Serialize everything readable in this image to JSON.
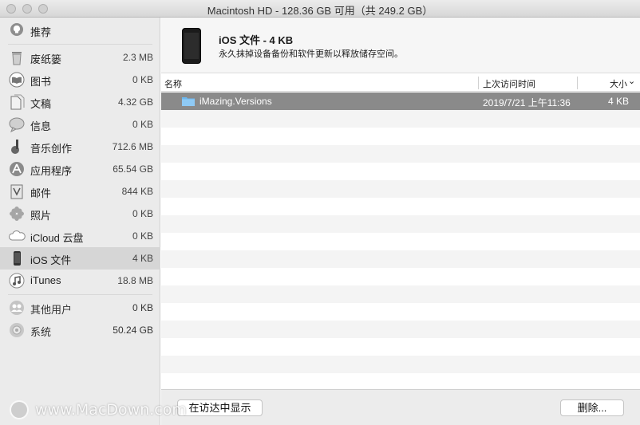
{
  "window": {
    "title": "Macintosh HD - 128.36 GB 可用（共 249.2 GB）"
  },
  "sidebar": {
    "items": [
      {
        "label": "推荐",
        "size": "",
        "icon": "lightbulb-icon"
      },
      {
        "label": "废纸篓",
        "size": "2.3 MB",
        "icon": "trash-icon"
      },
      {
        "label": "图书",
        "size": "0 KB",
        "icon": "books-icon"
      },
      {
        "label": "文稿",
        "size": "4.32 GB",
        "icon": "documents-icon"
      },
      {
        "label": "信息",
        "size": "0 KB",
        "icon": "messages-icon"
      },
      {
        "label": "音乐创作",
        "size": "712.6 MB",
        "icon": "guitar-icon"
      },
      {
        "label": "应用程序",
        "size": "65.54 GB",
        "icon": "app-store-icon"
      },
      {
        "label": "邮件",
        "size": "844 KB",
        "icon": "mail-icon"
      },
      {
        "label": "照片",
        "size": "0 KB",
        "icon": "photos-icon"
      },
      {
        "label": "iCloud 云盘",
        "size": "0 KB",
        "icon": "cloud-icon"
      },
      {
        "label": "iOS 文件",
        "size": "4 KB",
        "icon": "iphone-icon"
      },
      {
        "label": "iTunes",
        "size": "18.8 MB",
        "icon": "music-note-icon"
      },
      {
        "label": "其他用户",
        "size": "0 KB",
        "icon": "users-icon"
      },
      {
        "label": "系统",
        "size": "50.24 GB",
        "icon": "gear-icon"
      }
    ],
    "selected_index": 10
  },
  "header": {
    "title": "iOS 文件 - 4 KB",
    "description": "永久抹掉设备备份和软件更新以释放储存空间。"
  },
  "table": {
    "columns": [
      "名称",
      "上次访问时间",
      "大小"
    ],
    "sort_indicator": "⌄",
    "rows": [
      {
        "name": "iMazing.Versions",
        "date": "2019/7/21 上午11:36",
        "size": "4 KB",
        "icon": "folder-icon",
        "selected": true
      }
    ]
  },
  "footer": {
    "show_in_finder": "在访达中显示",
    "delete": "删除..."
  },
  "watermark": {
    "text": "www.MacDown.com"
  },
  "colors": {
    "selected_row": "#8a8a8a",
    "folder": "#6cb8f0"
  }
}
